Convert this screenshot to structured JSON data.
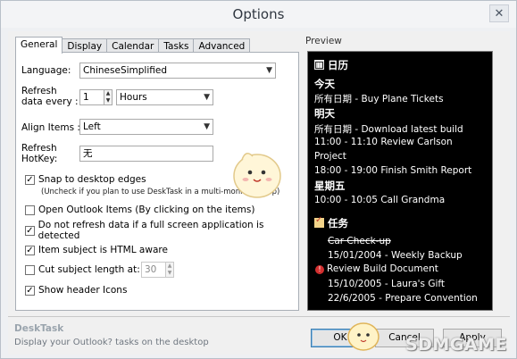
{
  "window": {
    "title": "Options",
    "close_glyph": "✕"
  },
  "tabs": [
    "General",
    "Display",
    "Calendar",
    "Tasks",
    "Advanced"
  ],
  "general": {
    "language_label": "Language:",
    "language_value": "ChineseSimplified",
    "refresh_label_1": "Refresh",
    "refresh_label_2": "data every :",
    "refresh_value": "1",
    "refresh_unit": "Hours",
    "align_label": "Align Items :",
    "align_value": "Left",
    "hotkey_label_1": "Refresh",
    "hotkey_label_2": "HotKey:",
    "hotkey_value": "无",
    "snap_label": "Snap to desktop edges",
    "snap_hint": "(Uncheck if you plan to use DeskTask in a multi-monitor setup)",
    "open_outlook_label": "Open Outlook Items (By clicking on the items)",
    "no_refresh_label": "Do not refresh data if a full screen application is detected",
    "html_aware_label": "Item subject is HTML aware",
    "cut_subject_label": "Cut subject length at:",
    "cut_subject_value": "30",
    "show_header_icons_label": "Show header Icons",
    "check_glyph": "✓"
  },
  "preview": {
    "label": "Preview",
    "calendar_header": "日历",
    "today": "今天",
    "today_item": "所有日期 - Buy Plane Tickets",
    "tomorrow": "明天",
    "tomorrow_item_1": "所有日期 - Download latest build",
    "tomorrow_item_2a": "11:00 - 11:10 Review Carlson",
    "tomorrow_item_2b": "Project",
    "tomorrow_item_3": "18:00 - 19:00 Finish Smith Report",
    "wednesday": "星期五",
    "wednesday_item": "10:00 - 10:05 Call Grandma",
    "tasks_header": "任务",
    "task_1": "Car Check-up",
    "task_2": "15/01/2004 - Weekly Backup",
    "task_3": "Review Build Document",
    "task_4": "15/10/2005 - Laura's Gift",
    "task_5": "22/6/2005 - Prepare Convention",
    "alert_glyph": "!"
  },
  "footer": {
    "app_name": "DeskTask",
    "description": "Display your Outlook? tasks on the desktop",
    "ok_label": "OK",
    "cancel_label": "Cancel",
    "apply_label": "Apply"
  },
  "watermark": "SDMGAME"
}
